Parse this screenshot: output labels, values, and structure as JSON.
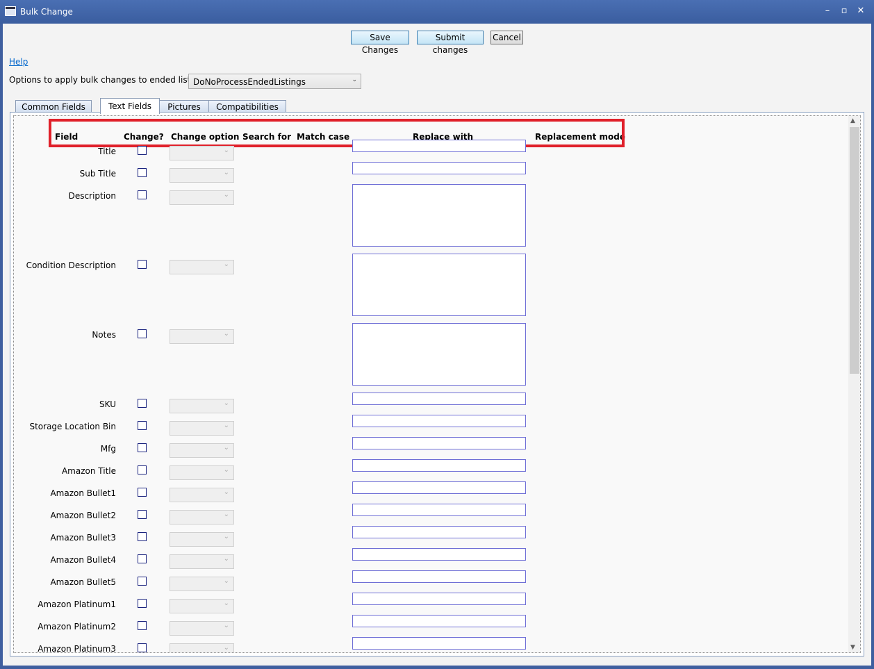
{
  "window": {
    "title": "Bulk Change"
  },
  "toolbar": {
    "save_label": "Save Changes",
    "submit_label": "Submit changes",
    "cancel_label": "Cancel"
  },
  "help_link": "Help",
  "ended_listings": {
    "label": "Options to apply bulk changes to ended listings:",
    "value": "DoNoProcessEndedListings"
  },
  "tabs": [
    "Common Fields",
    "Text Fields",
    "Pictures",
    "Compatibilities"
  ],
  "headers": [
    "Field",
    "Change?",
    "Change option",
    "Search for",
    "Match case",
    "Replace with",
    "Replacement mode"
  ],
  "fields": [
    "Title",
    "Sub Title",
    "Description",
    "Condition Description",
    "Notes",
    "SKU",
    "Storage Location Bin",
    "Mfg",
    "Amazon Title",
    "Amazon Bullet1",
    "Amazon Bullet2",
    "Amazon Bullet3",
    "Amazon Bullet4",
    "Amazon Bullet5",
    "Amazon Platinum1",
    "Amazon Platinum2",
    "Amazon Platinum3"
  ]
}
